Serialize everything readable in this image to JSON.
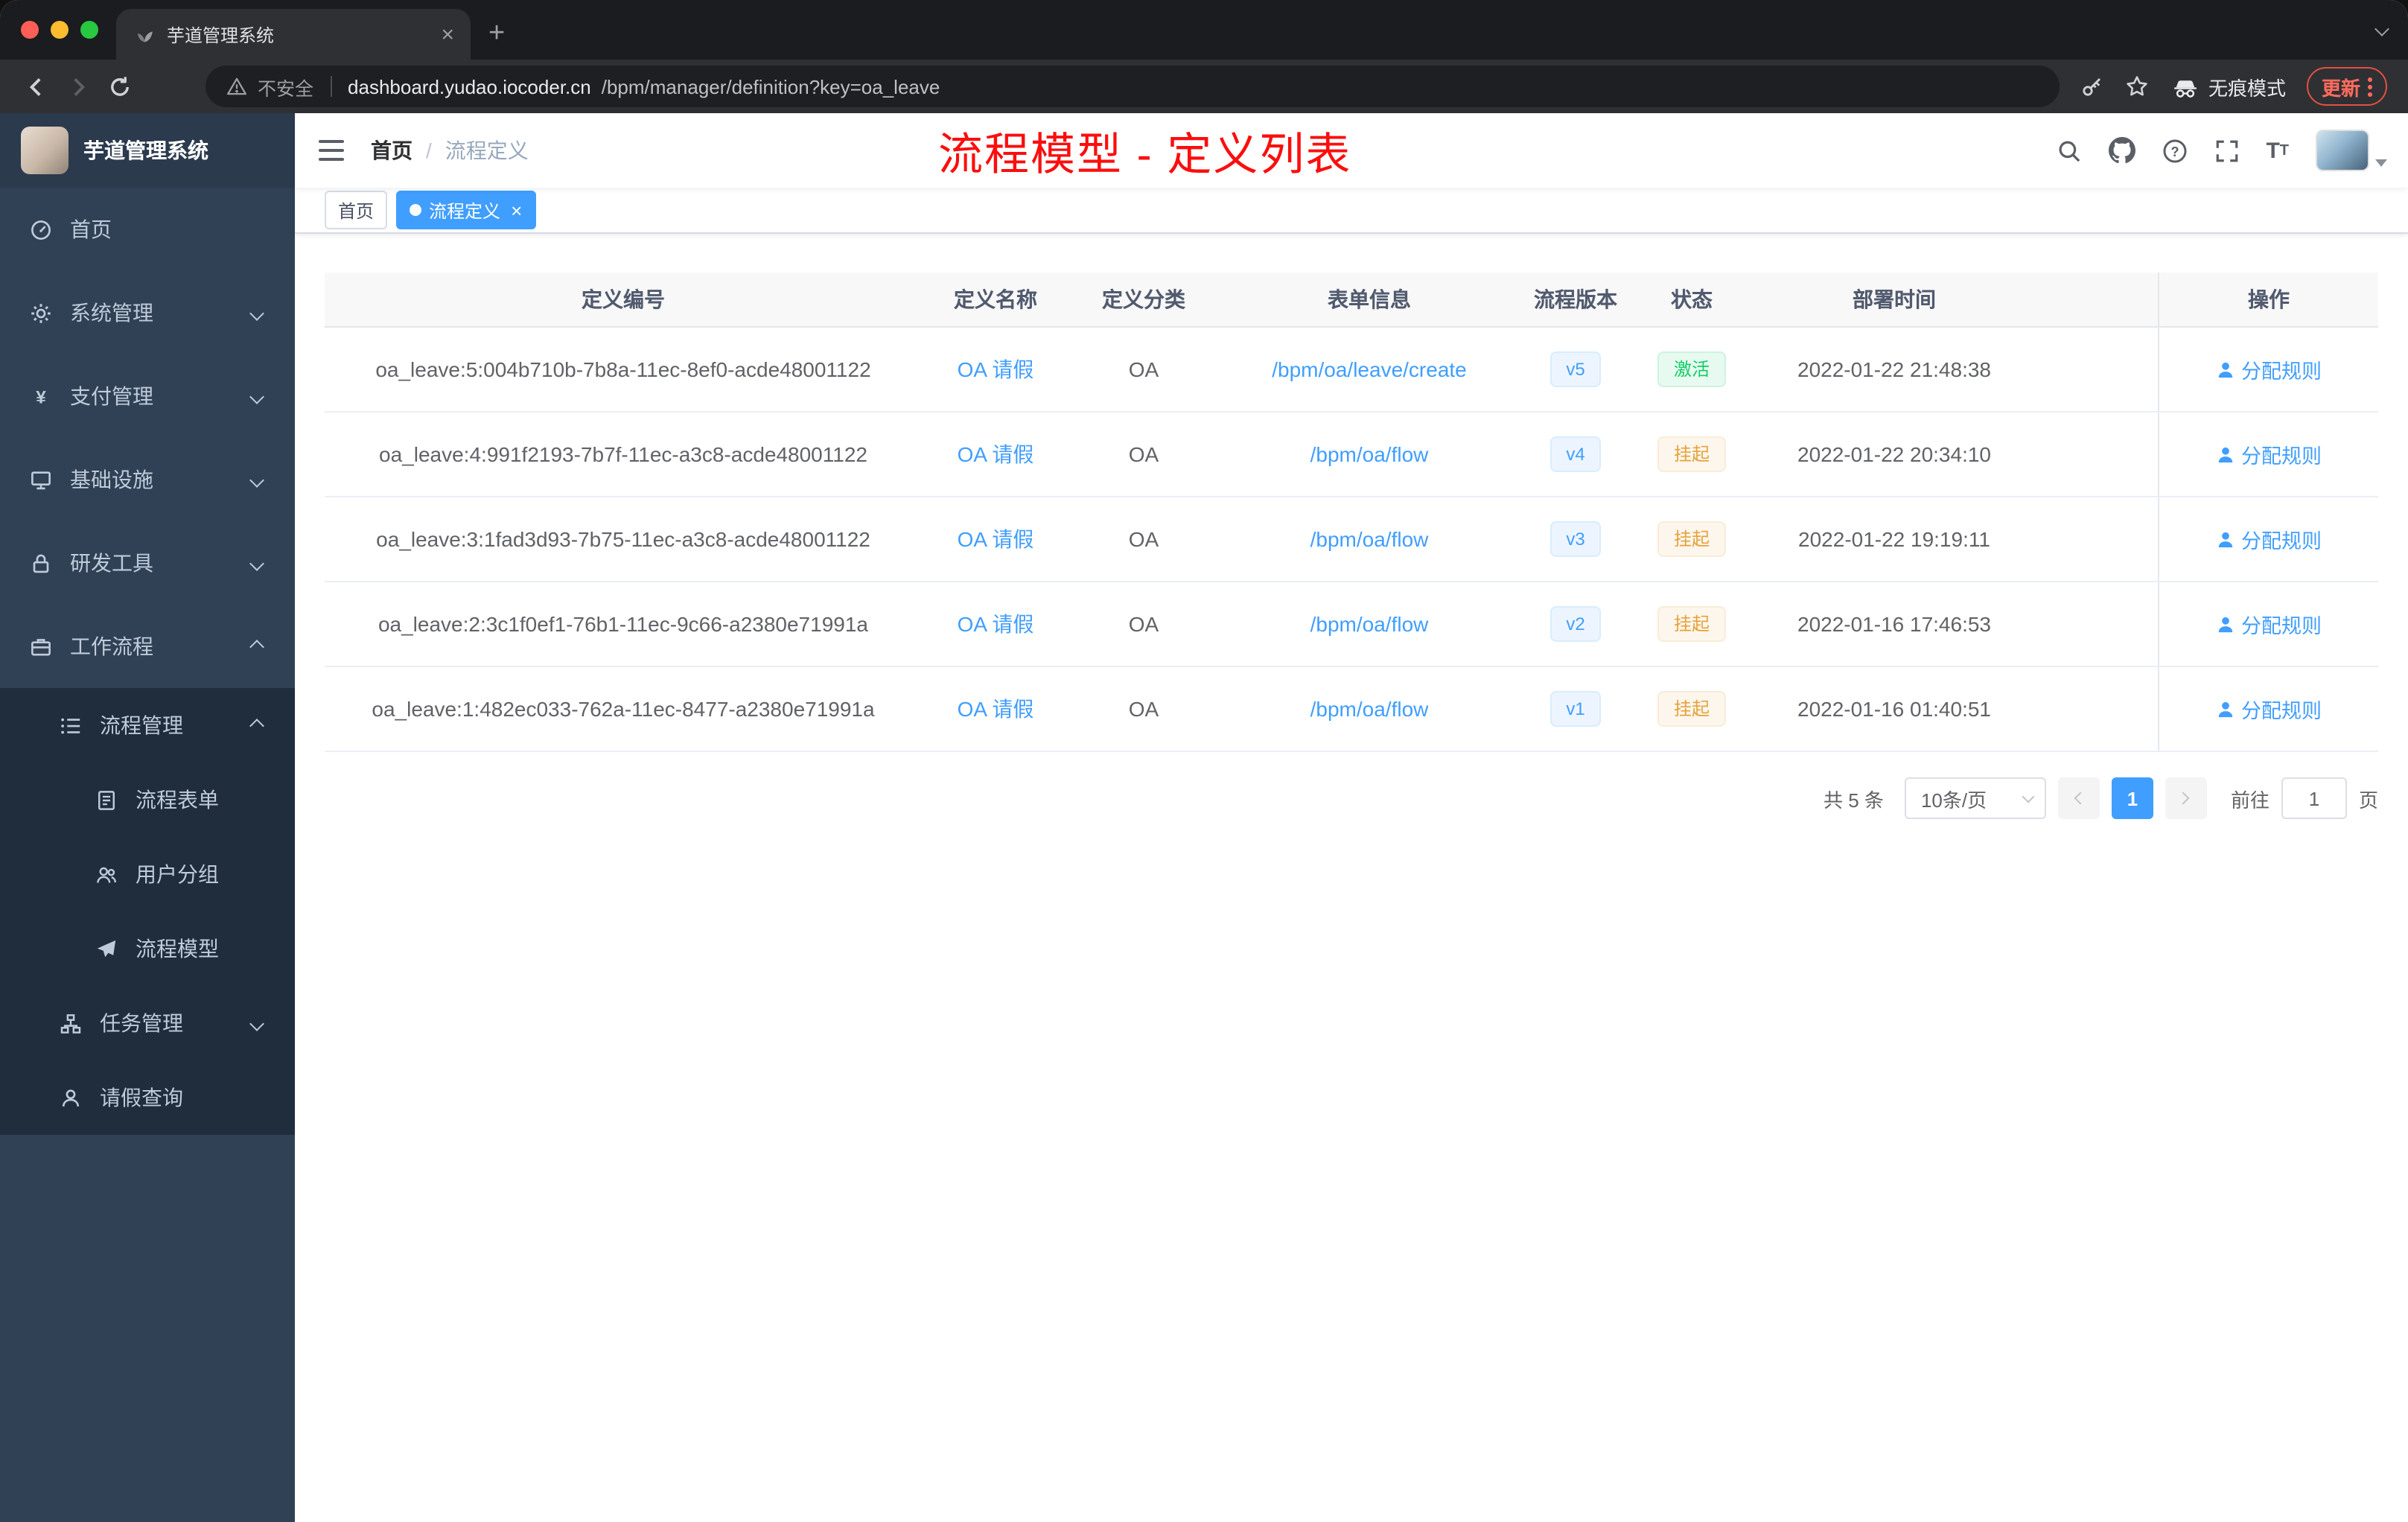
{
  "colors": {
    "primary": "#409eff",
    "success": "#13ce66",
    "warning": "#e6a23c",
    "annotation": "#fb0e0e",
    "sidebar_bg": "#304156",
    "submenu_bg": "#1f2d3d"
  },
  "browser": {
    "tab_title": "芋道管理系统",
    "security_label": "不安全",
    "url_domain": "dashboard.yudao.iocoder.cn",
    "url_path": "/bpm/manager/definition?key=oa_leave",
    "incognito_label": "无痕模式",
    "update_label": "更新"
  },
  "sidebar": {
    "logo_title": "芋道管理系统",
    "items": [
      {
        "label": "首页"
      },
      {
        "label": "系统管理"
      },
      {
        "label": "支付管理"
      },
      {
        "label": "基础设施"
      },
      {
        "label": "研发工具"
      },
      {
        "label": "工作流程"
      },
      {
        "label": "流程管理"
      },
      {
        "label": "流程表单"
      },
      {
        "label": "用户分组"
      },
      {
        "label": "流程模型"
      },
      {
        "label": "任务管理"
      },
      {
        "label": "请假查询"
      }
    ]
  },
  "header": {
    "breadcrumb_home": "首页",
    "breadcrumb_current": "流程定义",
    "annotation_title": "流程模型 - 定义列表"
  },
  "tags": {
    "home": "首页",
    "active": "流程定义"
  },
  "table": {
    "columns": [
      "定义编号",
      "定义名称",
      "定义分类",
      "表单信息",
      "流程版本",
      "状态",
      "部署时间",
      "操作"
    ],
    "rows": [
      {
        "id": "oa_leave:5:004b710b-7b8a-11ec-8ef0-acde48001122",
        "name": "OA 请假",
        "category": "OA",
        "form": "/bpm/oa/leave/create",
        "version": "v5",
        "status": "激活",
        "time": "2022-01-22 21:48:38",
        "action": "分配规则"
      },
      {
        "id": "oa_leave:4:991f2193-7b7f-11ec-a3c8-acde48001122",
        "name": "OA 请假",
        "category": "OA",
        "form": "/bpm/oa/flow",
        "version": "v4",
        "status": "挂起",
        "time": "2022-01-22 20:34:10",
        "action": "分配规则"
      },
      {
        "id": "oa_leave:3:1fad3d93-7b75-11ec-a3c8-acde48001122",
        "name": "OA 请假",
        "category": "OA",
        "form": "/bpm/oa/flow",
        "version": "v3",
        "status": "挂起",
        "time": "2022-01-22 19:19:11",
        "action": "分配规则"
      },
      {
        "id": "oa_leave:2:3c1f0ef1-76b1-11ec-9c66-a2380e71991a",
        "name": "OA 请假",
        "category": "OA",
        "form": "/bpm/oa/flow",
        "version": "v2",
        "status": "挂起",
        "time": "2022-01-16 17:46:53",
        "action": "分配规则"
      },
      {
        "id": "oa_leave:1:482ec033-762a-11ec-8477-a2380e71991a",
        "name": "OA 请假",
        "category": "OA",
        "form": "/bpm/oa/flow",
        "version": "v1",
        "status": "挂起",
        "time": "2022-01-16 01:40:51",
        "action": "分配规则"
      }
    ]
  },
  "pagination": {
    "total": "共 5 条",
    "page_size": "10条/页",
    "current_page": "1",
    "goto_label": "前往",
    "goto_value": "1",
    "page_unit": "页"
  }
}
